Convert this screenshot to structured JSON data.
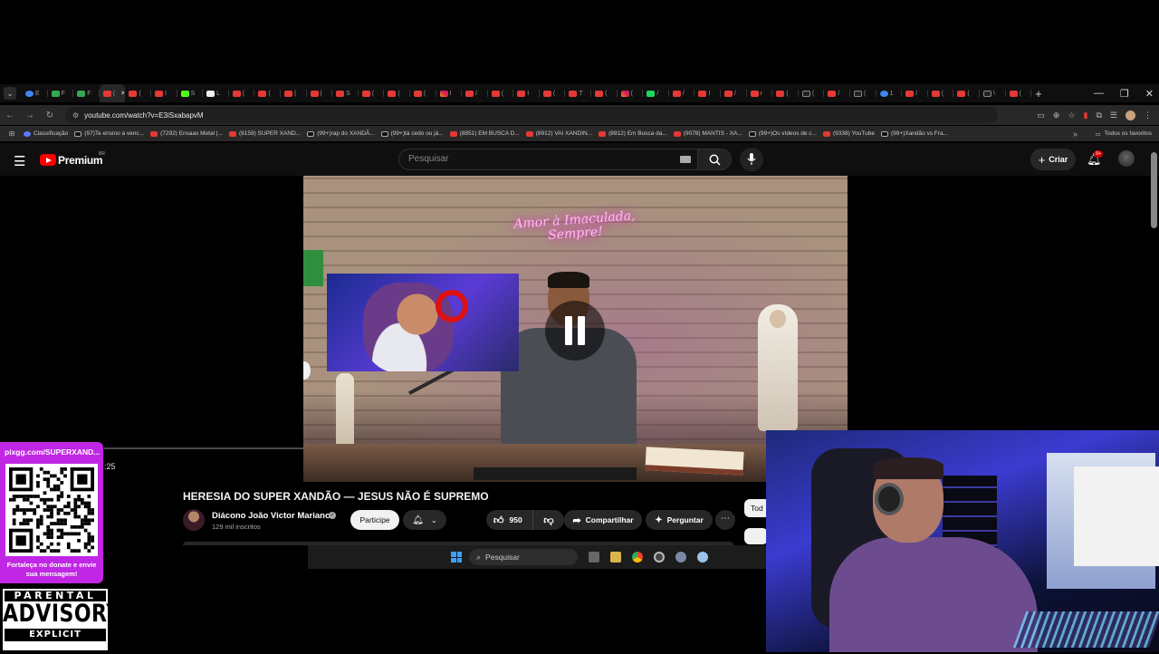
{
  "browser": {
    "url": "youtube.com/watch?v=E3iSxabapvM",
    "tabs": [
      {
        "icon": "chrome-tab-icon",
        "letter": "E"
      },
      {
        "icon": "link-icon",
        "letter": "F"
      },
      {
        "icon": "link-icon",
        "letter": "F"
      },
      {
        "icon": "youtube-icon",
        "letter": "("
      },
      {
        "icon": "youtube-icon",
        "letter": "("
      },
      {
        "icon": "youtube-icon",
        "letter": "I"
      },
      {
        "icon": "kick-icon",
        "letter": "S"
      },
      {
        "icon": "page-icon",
        "letter": "L"
      },
      {
        "icon": "youtube-icon",
        "letter": "("
      },
      {
        "icon": "youtube-icon",
        "letter": "("
      },
      {
        "icon": "youtube-icon",
        "letter": "("
      },
      {
        "icon": "youtube-icon",
        "letter": "("
      },
      {
        "icon": "youtube-icon",
        "letter": "S"
      },
      {
        "icon": "youtube-icon",
        "letter": "("
      },
      {
        "icon": "youtube-icon",
        "letter": "("
      },
      {
        "icon": "youtube-icon",
        "letter": "("
      },
      {
        "icon": "instagram-icon",
        "letter": "I"
      },
      {
        "icon": "youtube-icon",
        "letter": "/"
      },
      {
        "icon": "youtube-icon",
        "letter": "("
      },
      {
        "icon": "youtube-icon",
        "letter": "I"
      },
      {
        "icon": "youtube-icon",
        "letter": "("
      },
      {
        "icon": "youtube-icon",
        "letter": "T"
      },
      {
        "icon": "youtube-icon",
        "letter": "("
      },
      {
        "icon": "instagram-icon",
        "letter": "("
      },
      {
        "icon": "vfav-icon",
        "letter": "/"
      },
      {
        "icon": "youtube-icon",
        "letter": "/"
      },
      {
        "icon": "youtube-icon",
        "letter": "I"
      },
      {
        "icon": "youtube-icon",
        "letter": "/"
      },
      {
        "icon": "youtube-icon",
        "letter": "r"
      },
      {
        "icon": "youtube-icon",
        "letter": "("
      },
      {
        "icon": "tiktok-icon",
        "letter": "("
      },
      {
        "icon": "youtube-icon",
        "letter": "/"
      },
      {
        "icon": "tiktok-icon",
        "letter": "("
      },
      {
        "icon": "blue-circle-icon",
        "letter": "1"
      },
      {
        "icon": "youtube-icon",
        "letter": "/"
      },
      {
        "icon": "youtube-icon",
        "letter": "("
      },
      {
        "icon": "youtube-icon",
        "letter": "("
      },
      {
        "icon": "tiktok-icon",
        "letter": "\\"
      },
      {
        "icon": "youtube-icon",
        "letter": "("
      }
    ],
    "bookmarks": [
      {
        "label": "Classificação",
        "kind": "cls"
      },
      {
        "label": "(97)Te ensino a venc...",
        "kind": "tk"
      },
      {
        "label": "(7292) Ensaas Metal |...",
        "kind": "yt"
      },
      {
        "label": "(8159) SUPER XAND...",
        "kind": "yt"
      },
      {
        "label": "(99+)rap do XANDÃ...",
        "kind": "tk"
      },
      {
        "label": "(99+)tá cedo ou já...",
        "kind": "tk"
      },
      {
        "label": "(8851) EM BUSCA D...",
        "kind": "yt"
      },
      {
        "label": "(8912) VAI XANDIN...",
        "kind": "yt"
      },
      {
        "label": "(8912) Em Busca da...",
        "kind": "yt"
      },
      {
        "label": "(9078) MANTIS - XA...",
        "kind": "yt"
      },
      {
        "label": "(99+)Os vídeos de c...",
        "kind": "tk"
      },
      {
        "label": "(9338) YouTube",
        "kind": "yt"
      },
      {
        "label": "(99+)Xandão vs Fra...",
        "kind": "tk"
      }
    ],
    "all_bookmarks_label": "Todos os favoritos"
  },
  "youtube": {
    "logo_text": "Premium",
    "region": "BR",
    "search_placeholder": "Pesquisar",
    "create_label": "Criar",
    "notifications_badge": "9+"
  },
  "video": {
    "neon_sign": "Amor à Imaculada, Sempre!",
    "state": "paused",
    "time_fragment": ":25",
    "title": "HERESIA DO SUPER XANDÃO — JESUS NÃO É SUPREMO",
    "channel_name": "Diácono João Victor Mariano",
    "subscribers": "129 mil inscritos",
    "join_label": "Participe",
    "likes": "950",
    "share_label": "Compartilhar",
    "ask_label": "Perguntar",
    "chip_label": "Tod"
  },
  "taskbar": {
    "search_placeholder": "Pesquisar"
  },
  "overlay": {
    "donate_url": "pixgg.com/SUPERXAND...",
    "donate_message": "Fortaleça no donate e envie sua mensagem!",
    "advisory_top": "PARENTAL",
    "advisory_mid": "ADVISORY",
    "advisory_bottom": "EXPLICIT CONTENT"
  },
  "colors": {
    "youtube_red": "#ff0000",
    "donate_magenta": "#c026e3",
    "dark_bg": "#0f0f0f"
  }
}
